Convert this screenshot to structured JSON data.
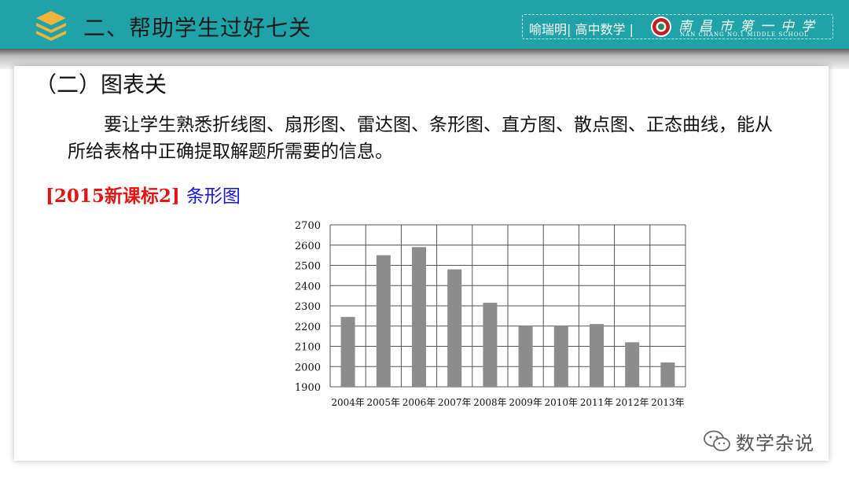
{
  "header": {
    "title": "二、帮助学生过好七关",
    "badge_text": "喻瑞明| 高中数学 |",
    "school_name": "南昌市第一中学",
    "school_en": "NAN CHANG NO.1 MIDDLE SCHOOL",
    "icon": "layers-stack-icon",
    "seal_icon": "school-seal-icon",
    "colors": {
      "bar": "#1fa3a8",
      "accent": "#f2b33a",
      "seal": "#c41e24"
    }
  },
  "section": {
    "title": "（二）图表关"
  },
  "paragraph": "要让学生熟悉折线图、扇形图、雷达图、条形图、直方图、散点图、正态曲线，能从所给表格中正确提取解题所需要的信息。",
  "problem": {
    "source": "[2015新课标2]",
    "kind": "条形图",
    "source_color": "#e01616",
    "kind_color": "#1717d8"
  },
  "chart_data": {
    "type": "bar",
    "categories": [
      "2004年",
      "2005年",
      "2006年",
      "2007年",
      "2008年",
      "2009年",
      "2010年",
      "2011年",
      "2012年",
      "2013年"
    ],
    "values": [
      2245,
      2550,
      2590,
      2480,
      2315,
      2200,
      2200,
      2210,
      2120,
      2020
    ],
    "ylim": [
      1900,
      2700
    ],
    "yticks": [
      1900,
      2000,
      2100,
      2200,
      2300,
      2400,
      2500,
      2600,
      2700
    ],
    "grid": true,
    "bar_color": "#8c8c8c"
  },
  "watermark": {
    "text": "数学杂说",
    "icon": "wechat-icon"
  }
}
